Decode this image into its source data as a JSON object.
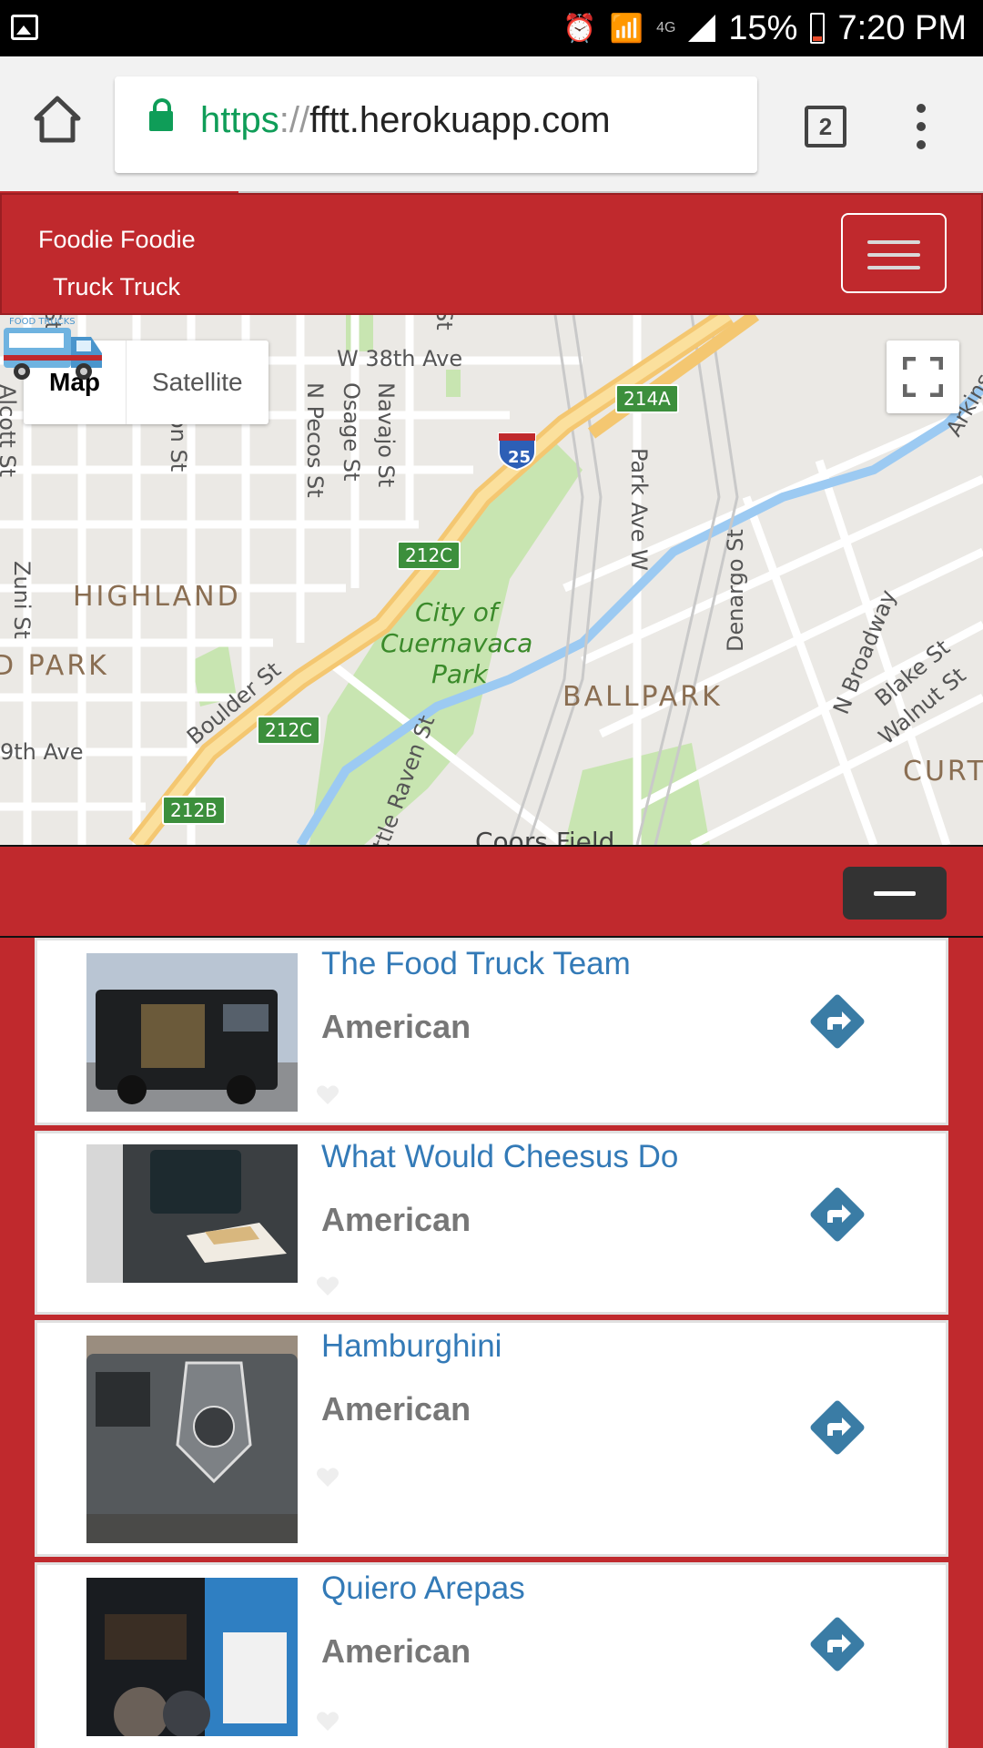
{
  "status_bar": {
    "battery": "15%",
    "time": "7:20 PM",
    "network": "4G"
  },
  "browser": {
    "url_scheme": "https",
    "url_slashes": "://",
    "url_host": "fftt.herokuapp.com",
    "tab_count": "2"
  },
  "navbar": {
    "brand_line1": "Foodie Foodie",
    "brand_line2": "Truck Truck"
  },
  "map": {
    "type_buttons": [
      "Map",
      "Satellite"
    ],
    "selected_type": "Map",
    "labels": {
      "w38th": "W 38th Ave",
      "highland": "HIGHLAND",
      "park": "D PARK",
      "ballpark": "BALLPARK",
      "curt": "CURT",
      "city_park_1": "City of",
      "city_park_2": "Cuernavaca",
      "city_park_3": "Park",
      "zuni": "Zuni St",
      "pecos": "N Pecos St",
      "osage": "Osage St",
      "navajo": "Navajo St",
      "park_ave": "Park Ave W",
      "denargo": "Denargo St",
      "broadway": "N Broadway",
      "blake": "Blake St",
      "walnut": "Walnut St",
      "boulder": "Boulder St",
      "raven": "ttle Raven St",
      "ninth": "9th Ave",
      "alcott": "Alcott St",
      "arkins": "Arkins C",
      "coors": "Coors Field",
      "st_top1": "St",
      "st_top2": "St",
      "on_st": "on St"
    },
    "shields": [
      "214A",
      "212C",
      "212C",
      "212B"
    ],
    "interstate": "25",
    "truck_marker_text": "FOOD TRUCKS"
  },
  "trucks": [
    {
      "name": "The Food Truck Team",
      "cuisine": "American"
    },
    {
      "name": "What Would Cheesus Do",
      "cuisine": "American"
    },
    {
      "name": "Hamburghini",
      "cuisine": "American"
    },
    {
      "name": "Quiero Arepas",
      "cuisine": "American"
    }
  ],
  "colors": {
    "brand_red": "#c0292d",
    "link_blue": "#337ab7",
    "directions_blue": "#3a7ca5",
    "secure_green": "#0f9d58"
  }
}
